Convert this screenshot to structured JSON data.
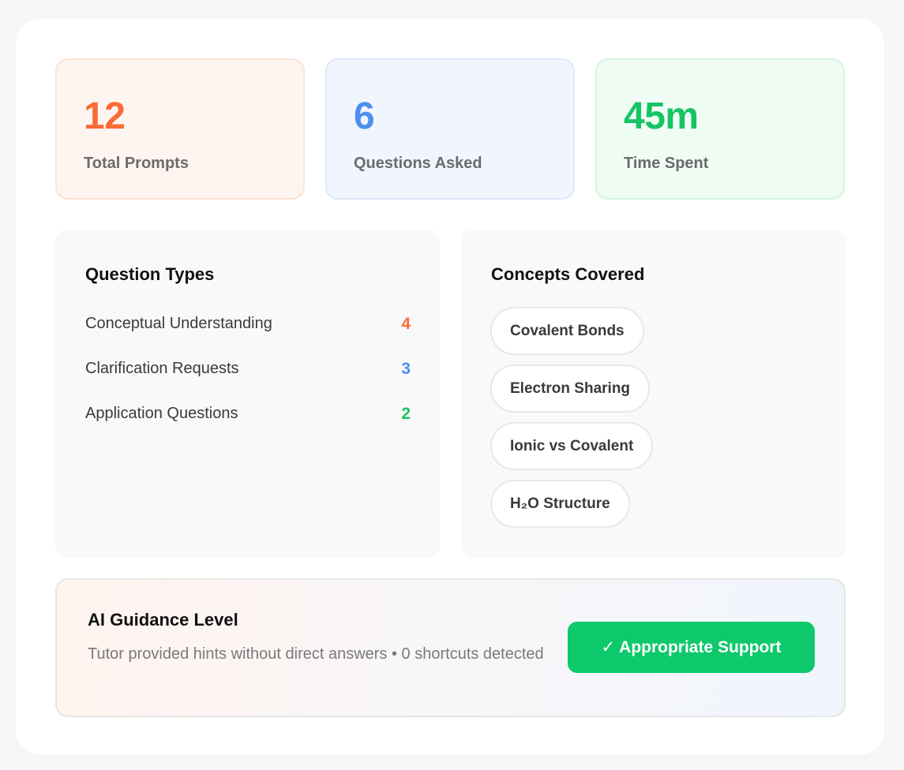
{
  "stats": [
    {
      "value": "12",
      "label": "Total Prompts",
      "color": "#fb6a37"
    },
    {
      "value": "6",
      "label": "Questions Asked",
      "color": "#4d8ff0"
    },
    {
      "value": "45m",
      "label": "Time Spent",
      "color": "#16c466"
    }
  ],
  "question_types": {
    "title": "Question Types",
    "items": [
      {
        "label": "Conceptual Understanding",
        "count": "4",
        "color": "#fb6a37"
      },
      {
        "label": "Clarification Requests",
        "count": "3",
        "color": "#4d8ff0"
      },
      {
        "label": "Application Questions",
        "count": "2",
        "color": "#16c466"
      }
    ]
  },
  "concepts": {
    "title": "Concepts Covered",
    "tags": [
      "Covalent Bonds",
      "Electron Sharing",
      "Ionic vs Covalent",
      "H₂O Structure"
    ]
  },
  "guidance": {
    "title": "AI Guidance Level",
    "description": "Tutor provided hints without direct answers • 0 shortcuts detected",
    "button_label": "✓ Appropriate Support",
    "button_color": "#0ec96b"
  }
}
